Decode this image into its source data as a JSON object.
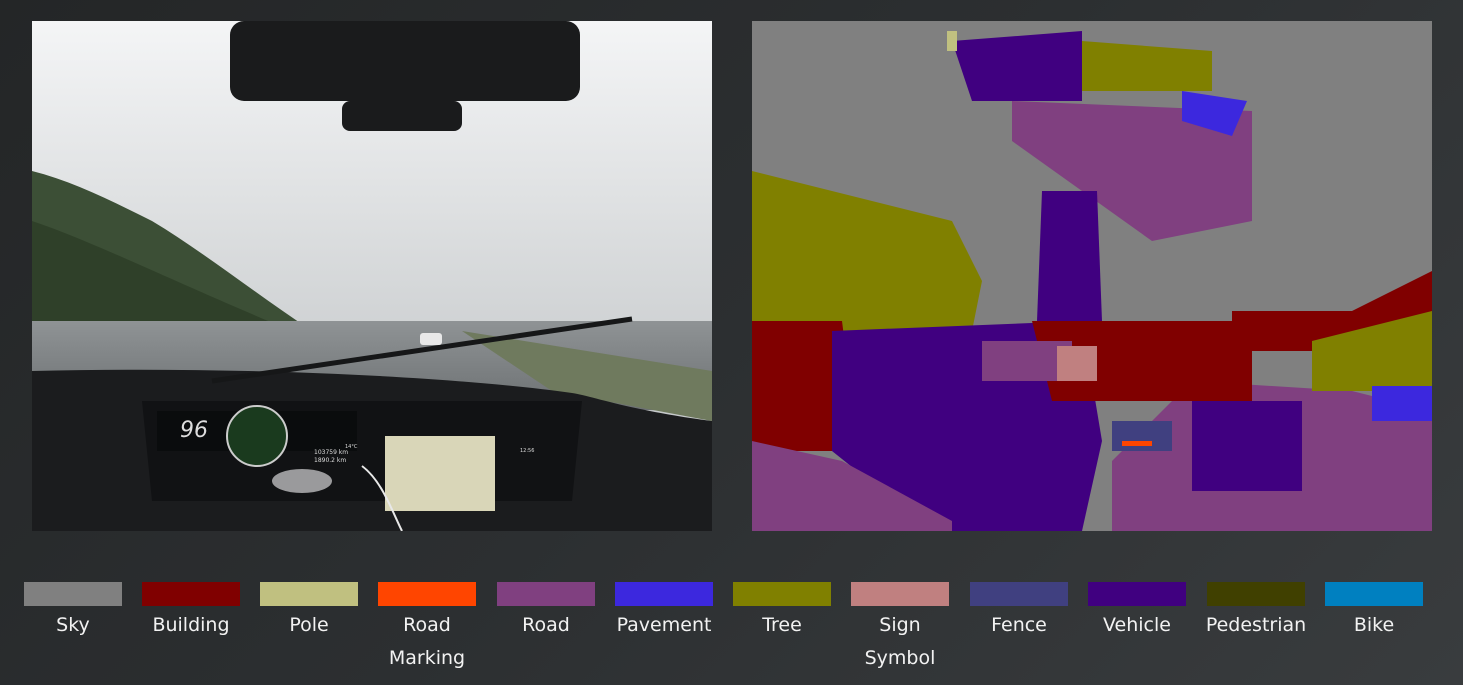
{
  "photo": {
    "dashboard": {
      "speed": "96",
      "odometer": "103759 km",
      "trip": "1890.2 km",
      "temperature": "14°C",
      "clock": "12:56"
    }
  },
  "legend": [
    {
      "label": "Sky",
      "color": "#808080"
    },
    {
      "label": "Building",
      "color": "#800000"
    },
    {
      "label": "Pole",
      "color": "#C0C080"
    },
    {
      "label": "Road Marking",
      "color": "#FF4500"
    },
    {
      "label": "Road",
      "color": "#804080"
    },
    {
      "label": "Pavement",
      "color": "#3C28DE"
    },
    {
      "label": "Tree",
      "color": "#808000"
    },
    {
      "label": "Sign Symbol",
      "color": "#C08080"
    },
    {
      "label": "Fence",
      "color": "#404080"
    },
    {
      "label": "Vehicle",
      "color": "#400080"
    },
    {
      "label": "Pedestrian",
      "color": "#404000"
    },
    {
      "label": "Bike",
      "color": "#0080C0"
    }
  ]
}
